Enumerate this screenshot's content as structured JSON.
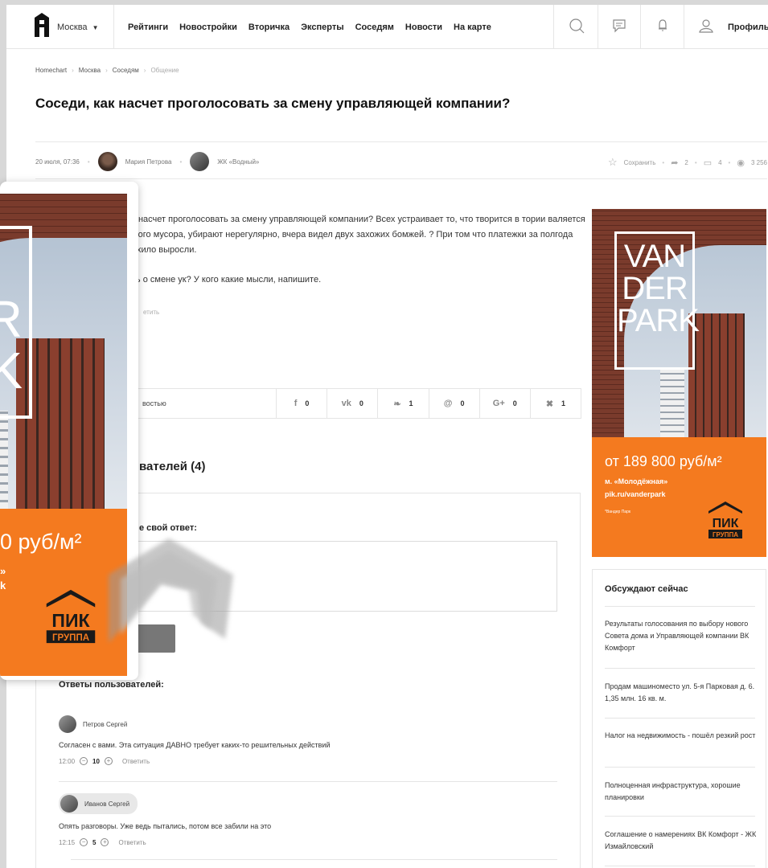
{
  "header": {
    "city": "Москва",
    "nav": [
      "Рейтинги",
      "Новостройки",
      "Вторичка",
      "Эксперты",
      "Соседям",
      "Новости",
      "На карте"
    ],
    "profile": "Профиль"
  },
  "breadcrumbs": [
    "Homechart",
    "Москва",
    "Соседям",
    "Общение"
  ],
  "post": {
    "title": "Соседи, как насчет проголосовать за смену управляющей компании?",
    "date": "20 июля, 07:36",
    "author": "Мария Петрова",
    "complex": "ЖК «Водный»",
    "save_label": "Сохранить",
    "shares": "2",
    "comments": "4",
    "views": "3 256",
    "paragraph1": "ак насчет проголосовать за смену управляющей компании? Всех устраивает то, что творится в тории валяется много мусора, убирают нерегулярно, вчера видел двух захожих бомжей. ? При том что платежки за полгода нехило выросли.",
    "paragraph2": "ать о смене ук? У кого какие мысли, напишите.",
    "reply_link": "етить"
  },
  "share": {
    "label": "востью",
    "items": [
      {
        "icon": "f",
        "name": "facebook-icon",
        "count": "0"
      },
      {
        "icon": "vk",
        "name": "vk-icon",
        "count": "0"
      },
      {
        "icon": "❧",
        "name": "twitter-icon",
        "count": "1"
      },
      {
        "icon": "@",
        "name": "mail-icon",
        "count": "0"
      },
      {
        "icon": "G+",
        "name": "google-plus-icon",
        "count": "0"
      },
      {
        "icon": "✖",
        "name": "odnoklassniki-icon",
        "count": "1"
      }
    ]
  },
  "answers": {
    "heading": "вателей (4)",
    "your_answer": "е свой ответ:",
    "sub_heading": "Ответы пользователей:",
    "comments": [
      {
        "author": "Петров Сергей",
        "text": "Согласен с вами. Эта ситуация ДАВНО требует каких-то решительных действий",
        "time": "12:00",
        "score": "10",
        "reply": "Ответить"
      },
      {
        "author": "Иванов Сергей",
        "text": "Опять разговоры. Уже ведь пытались, потом все забили на это",
        "time": "12:15",
        "score": "5",
        "reply": "Ответить"
      }
    ]
  },
  "ad": {
    "brand_line1": "VAN",
    "brand_line2": "DER",
    "brand_line3": "PARK",
    "price": "от 189 800 руб/м²",
    "metro": "м. «Молодёжная»",
    "url": "pik.ru/vanderpark",
    "note": "*Вандер Парк",
    "logo_top": "ПИК",
    "logo_bottom": "ГРУППА",
    "accent_color": "#f47a1f"
  },
  "zoom": {
    "brand_line1": "R",
    "brand_line2": "K",
    "price": "0 руб/м²",
    "metro": "»",
    "url": "k"
  },
  "discuss": {
    "heading": "Обсуждают сейчас",
    "items": [
      "Результаты голосования по выбору нового Совета дома и Управляющей компании ВК Комфорт",
      "Продам машиноместо ул. 5-я Парковая д. 6. 1,35 млн. 16 кв. м.",
      "Налог на недвижимость - пошёл резкий рост",
      "Полноценная инфраструктура, хорошие планировки",
      "Соглашение о намерениях ВК Комфорт - ЖК Измайловский"
    ]
  }
}
